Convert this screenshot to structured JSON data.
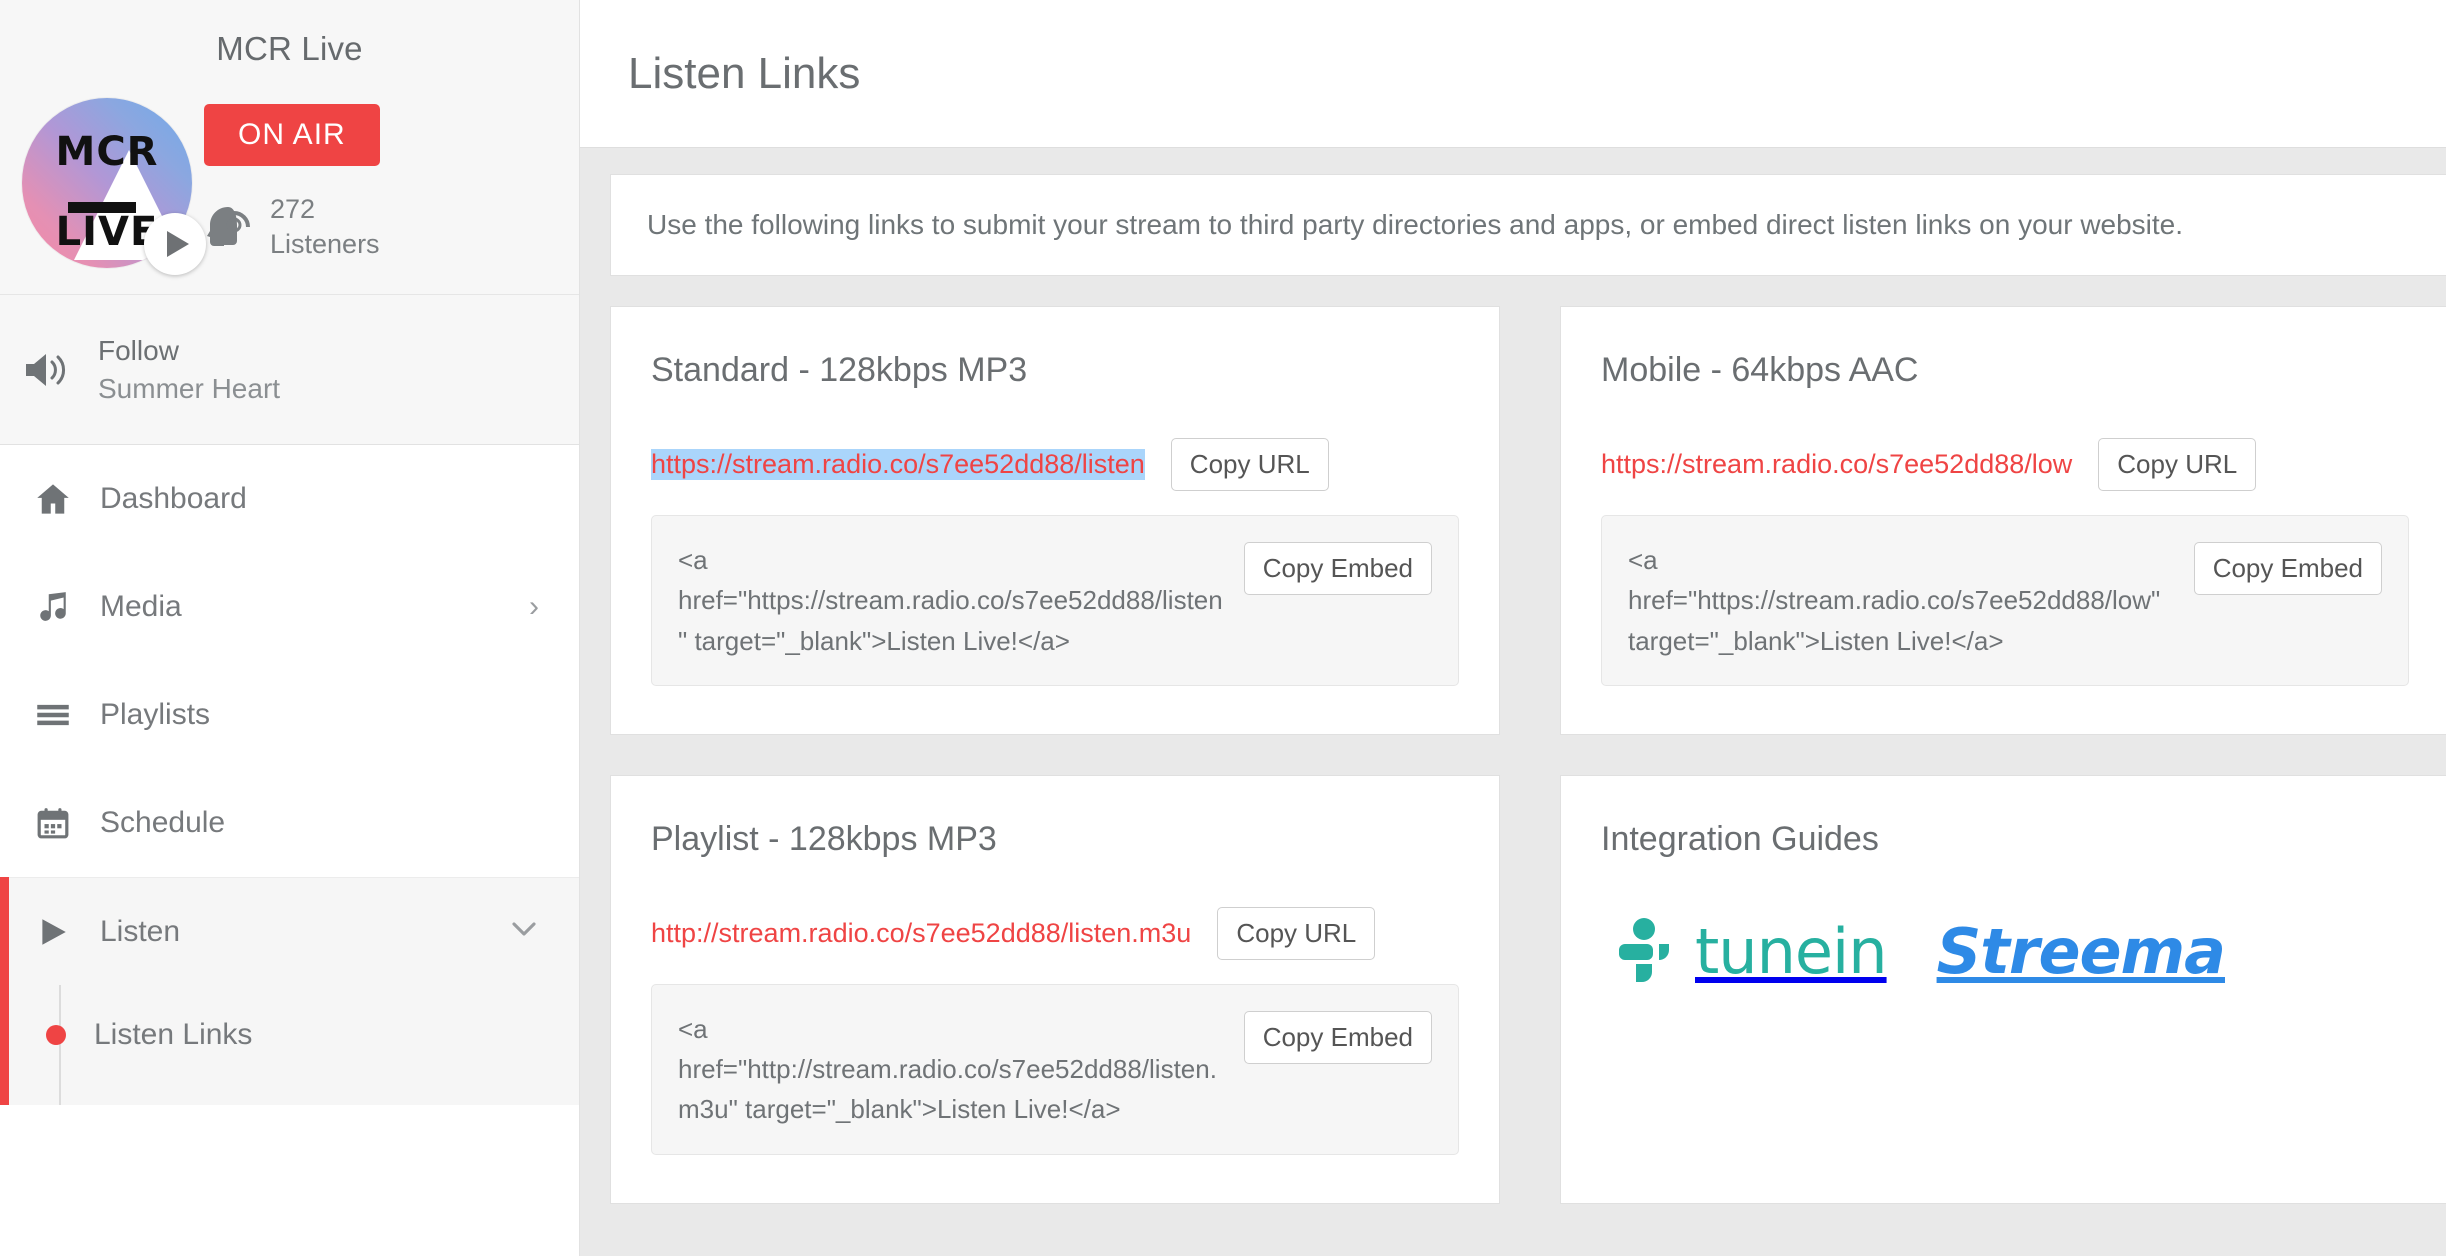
{
  "sidebar": {
    "station_name": "MCR Live",
    "logo": {
      "line1": "MCR",
      "line2": "LIVE",
      "alt": "mcr-live-logo"
    },
    "on_air_label": "ON AIR",
    "listeners_count": "272",
    "listeners_label": "Listeners",
    "follow": {
      "action": "Follow",
      "artist": "Summer Heart"
    },
    "nav_items": [
      {
        "label": "Dashboard",
        "icon": "home-icon",
        "chevron": ""
      },
      {
        "label": "Media",
        "icon": "music-note-icon",
        "chevron": "›"
      },
      {
        "label": "Playlists",
        "icon": "list-icon",
        "chevron": ""
      },
      {
        "label": "Schedule",
        "icon": "calendar-icon",
        "chevron": ""
      }
    ],
    "active_item": {
      "label": "Listen",
      "icon": "play-icon",
      "chevron": "⌄"
    },
    "sub_items": [
      {
        "label": "Listen Links",
        "active": true
      }
    ]
  },
  "header": {
    "page_title": "Listen Links"
  },
  "banner": {
    "text": "Use the following links to submit your stream to third party directories and apps, or embed direct listen links on your website."
  },
  "cards": [
    {
      "title": "Standard - 128kbps MP3",
      "url": "https://stream.radio.co/s7ee52dd88/listen",
      "url_selected": true,
      "copy_url_label": "Copy URL",
      "embed_code": "<a href=\"https://stream.radio.co/s7ee52dd88/listen\" target=\"_blank\">Listen Live!</a>",
      "copy_embed_label": "Copy Embed"
    },
    {
      "title": "Mobile - 64kbps AAC",
      "url": "https://stream.radio.co/s7ee52dd88/low",
      "url_selected": false,
      "copy_url_label": "Copy URL",
      "embed_code": "<a href=\"https://stream.radio.co/s7ee52dd88/low\" target=\"_blank\">Listen Live!</a>",
      "copy_embed_label": "Copy Embed"
    },
    {
      "title": "Playlist - 128kbps MP3",
      "url": "http://stream.radio.co/s7ee52dd88/listen.m3u",
      "url_selected": false,
      "copy_url_label": "Copy URL",
      "embed_code": "<a href=\"http://stream.radio.co/s7ee52dd88/listen.m3u\" target=\"_blank\">Listen Live!</a>",
      "copy_embed_label": "Copy Embed"
    }
  ],
  "integration": {
    "title": "Integration Guides",
    "logos": [
      {
        "name": "tunein",
        "label": "tunein",
        "color": "#27b0a0"
      },
      {
        "name": "streema",
        "label": "Streema",
        "color": "#2e8ae6"
      }
    ]
  },
  "colors": {
    "accent_red": "#ef4444",
    "link_red": "#ef4444",
    "selection_blue": "#aad5fb",
    "page_bg": "#e9e9e9"
  }
}
